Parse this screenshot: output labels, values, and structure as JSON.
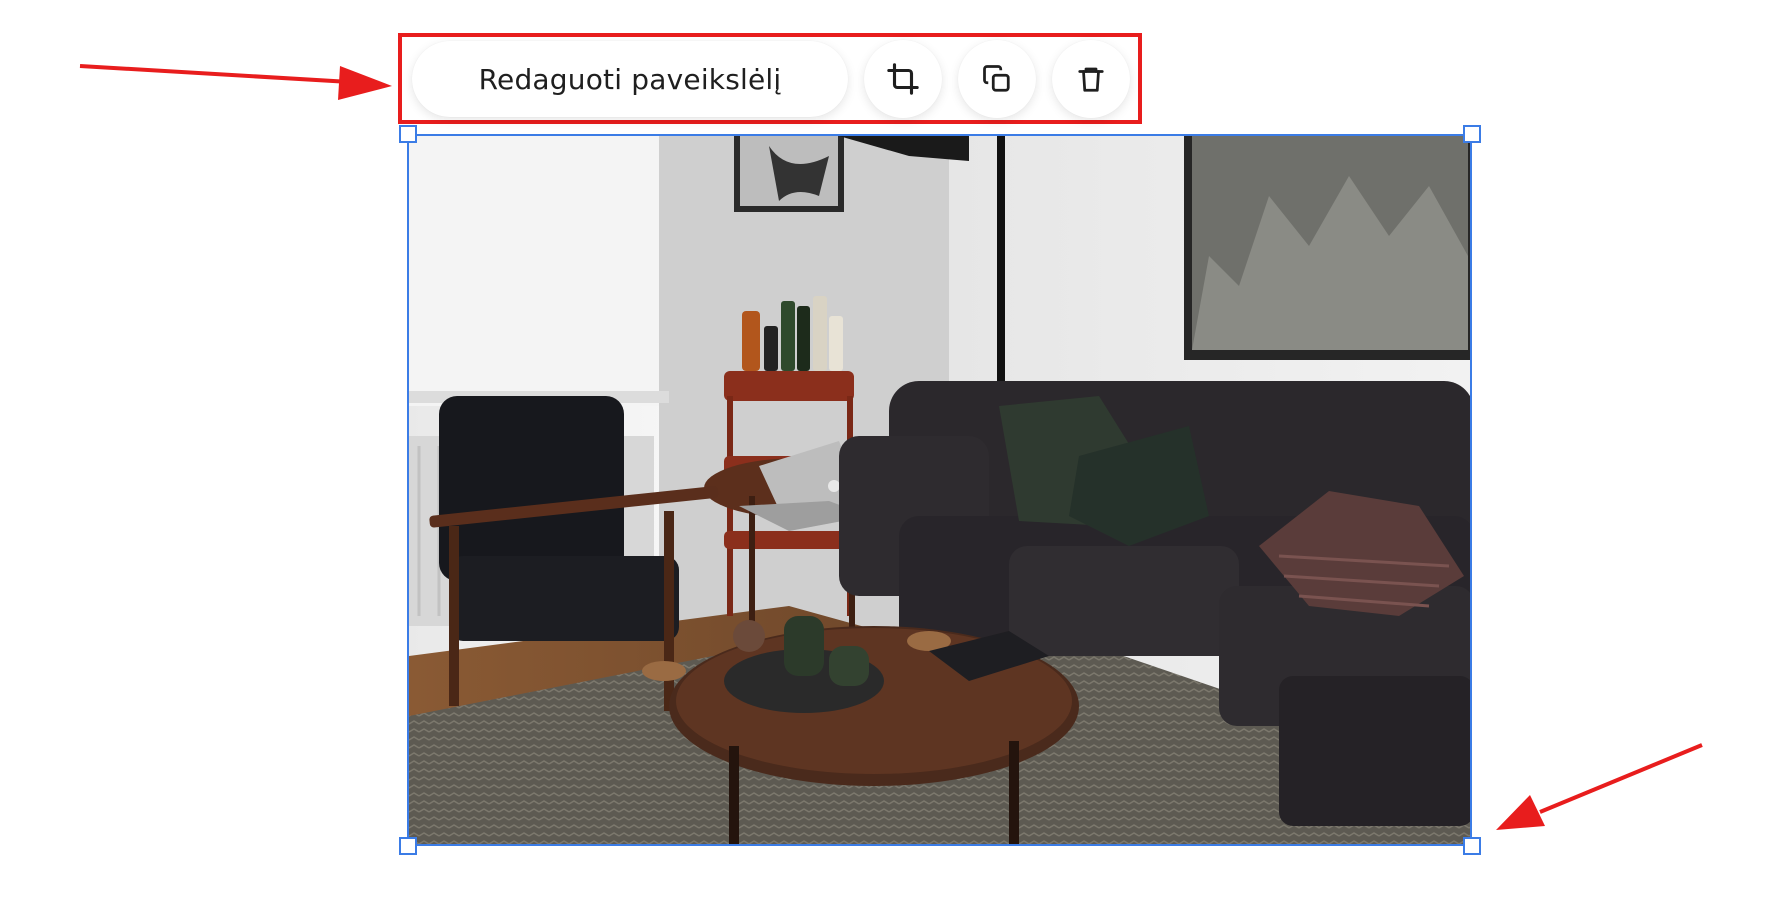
{
  "toolbar": {
    "edit_label": "Redaguoti paveikslėlį",
    "crop_icon": "crop-icon",
    "duplicate_icon": "duplicate-icon",
    "delete_icon": "trash-icon"
  },
  "image": {
    "subject": "living-room-photo"
  },
  "colors": {
    "highlight": "#e81d1d",
    "selection": "#3b7ce6",
    "arrow": "#e81d1d"
  }
}
